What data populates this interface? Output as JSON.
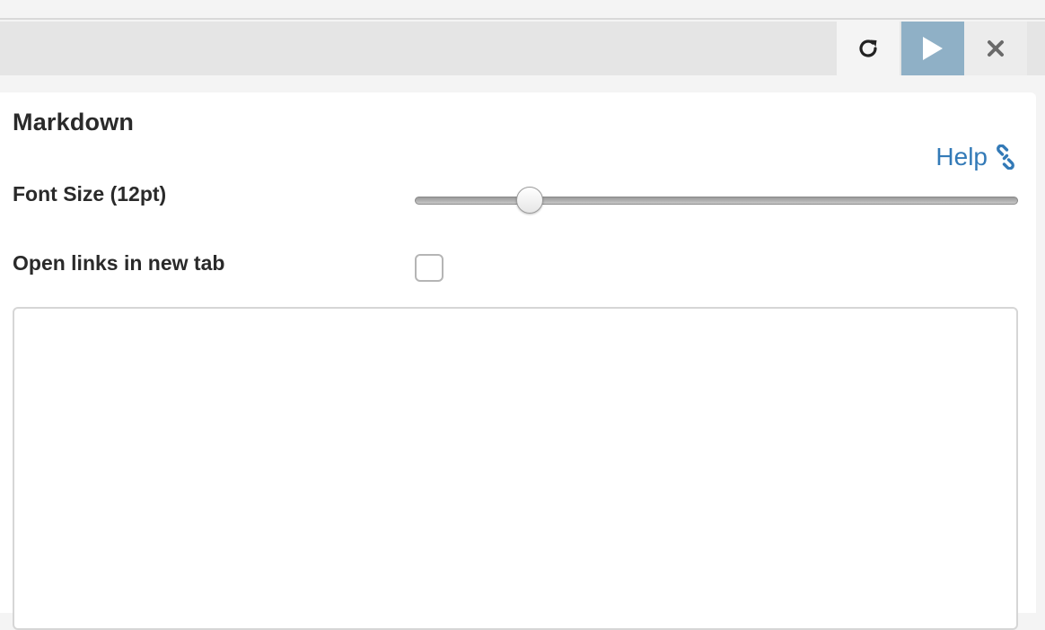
{
  "toolbar": {
    "refresh_icon": "refresh-icon",
    "run_icon": "play-icon",
    "close_icon": "close-icon",
    "run_color": "#8fb0c6"
  },
  "panel": {
    "title": "Markdown",
    "help_label": "Help",
    "help_icon": "link-icon",
    "link_color": "#337ab7"
  },
  "settings": {
    "font_size_label": "Font Size (12pt)",
    "font_size_slider_fraction": 0.19,
    "open_links_label": "Open links in new tab",
    "open_links_checked": false
  },
  "editor": {
    "value": ""
  }
}
